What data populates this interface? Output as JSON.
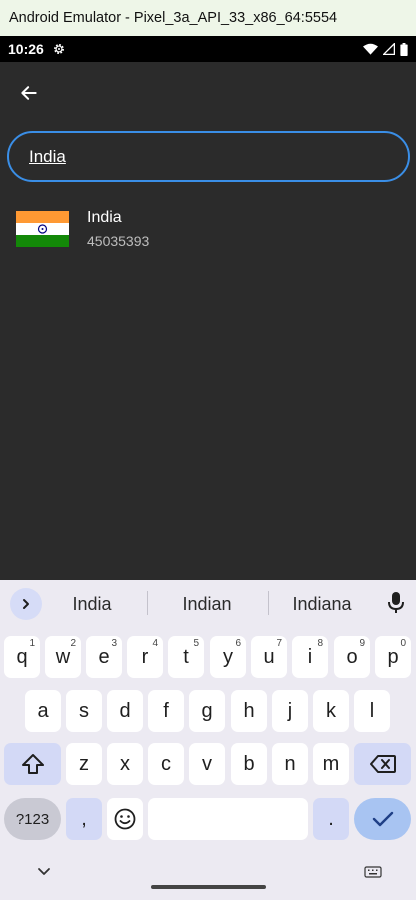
{
  "window": {
    "title": "Android Emulator - Pixel_3a_API_33_x86_64:5554"
  },
  "status_bar": {
    "time": "10:26"
  },
  "search": {
    "value": "India"
  },
  "results": [
    {
      "name": "India",
      "population": "45035393"
    }
  ],
  "keyboard": {
    "suggestions": [
      "India",
      "Indian",
      "Indiana"
    ],
    "row1": [
      {
        "k": "q",
        "n": "1"
      },
      {
        "k": "w",
        "n": "2"
      },
      {
        "k": "e",
        "n": "3"
      },
      {
        "k": "r",
        "n": "4"
      },
      {
        "k": "t",
        "n": "5"
      },
      {
        "k": "y",
        "n": "6"
      },
      {
        "k": "u",
        "n": "7"
      },
      {
        "k": "i",
        "n": "8"
      },
      {
        "k": "o",
        "n": "9"
      },
      {
        "k": "p",
        "n": "0"
      }
    ],
    "row2": [
      "a",
      "s",
      "d",
      "f",
      "g",
      "h",
      "j",
      "k",
      "l"
    ],
    "row3": [
      "z",
      "x",
      "c",
      "v",
      "b",
      "n",
      "m"
    ],
    "symbols_label": "?123",
    "comma_label": ",",
    "period_label": "."
  },
  "colors": {
    "app_background": "#2b2b2b",
    "search_border": "#3a8ee6",
    "keyboard_background": "#eceaf2",
    "enter_key": "#a8c4f2"
  }
}
